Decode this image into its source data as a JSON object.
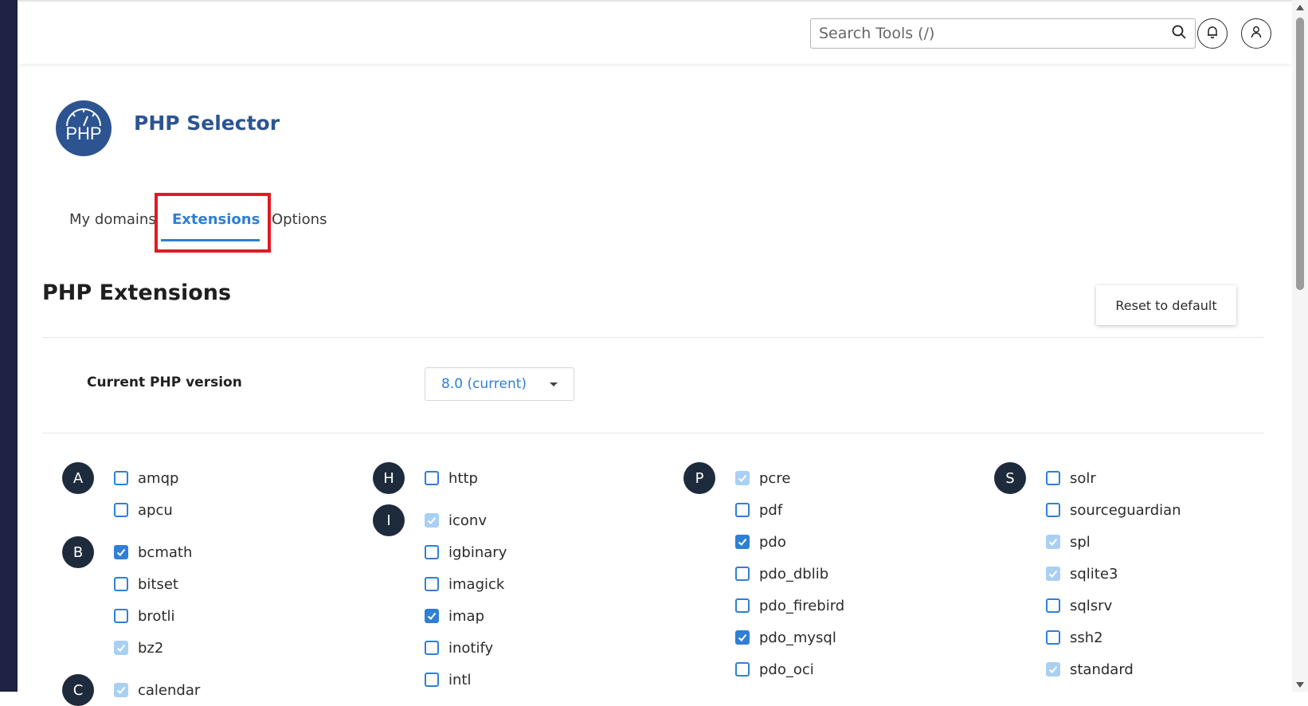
{
  "header": {
    "search_placeholder": "Search Tools (/)",
    "icons": [
      "search-icon",
      "bell-icon",
      "user-icon"
    ]
  },
  "app": {
    "title": "PHP Selector",
    "logo_text": "PHP"
  },
  "tabs": [
    {
      "label": "My domains",
      "active": false
    },
    {
      "label": "Extensions",
      "active": true
    },
    {
      "label": "Options",
      "active": false
    }
  ],
  "section": {
    "title": "PHP Extensions",
    "reset_label": "Reset to default"
  },
  "version": {
    "label": "Current PHP version",
    "selected": "8.0 (current)"
  },
  "columns": [
    {
      "groups": [
        {
          "letter": "A",
          "items": [
            {
              "name": "amqp",
              "state": "unchecked"
            },
            {
              "name": "apcu",
              "state": "unchecked"
            }
          ]
        },
        {
          "letter": "B",
          "items": [
            {
              "name": "bcmath",
              "state": "checked"
            },
            {
              "name": "bitset",
              "state": "unchecked"
            },
            {
              "name": "brotli",
              "state": "unchecked"
            },
            {
              "name": "bz2",
              "state": "default"
            }
          ]
        },
        {
          "letter": "C",
          "items": [
            {
              "name": "calendar",
              "state": "default"
            }
          ]
        }
      ]
    },
    {
      "groups": [
        {
          "letter": "H",
          "items": [
            {
              "name": "http",
              "state": "unchecked"
            }
          ]
        },
        {
          "letter": "I",
          "items": [
            {
              "name": "iconv",
              "state": "default"
            },
            {
              "name": "igbinary",
              "state": "unchecked"
            },
            {
              "name": "imagick",
              "state": "unchecked"
            },
            {
              "name": "imap",
              "state": "checked"
            },
            {
              "name": "inotify",
              "state": "unchecked"
            },
            {
              "name": "intl",
              "state": "unchecked"
            }
          ]
        }
      ]
    },
    {
      "groups": [
        {
          "letter": "P",
          "items": [
            {
              "name": "pcre",
              "state": "default"
            },
            {
              "name": "pdf",
              "state": "unchecked"
            },
            {
              "name": "pdo",
              "state": "checked"
            },
            {
              "name": "pdo_dblib",
              "state": "unchecked"
            },
            {
              "name": "pdo_firebird",
              "state": "unchecked"
            },
            {
              "name": "pdo_mysql",
              "state": "checked"
            },
            {
              "name": "pdo_oci",
              "state": "unchecked"
            }
          ]
        }
      ]
    },
    {
      "groups": [
        {
          "letter": "S",
          "items": [
            {
              "name": "solr",
              "state": "unchecked"
            },
            {
              "name": "sourceguardian",
              "state": "unchecked"
            },
            {
              "name": "spl",
              "state": "default"
            },
            {
              "name": "sqlite3",
              "state": "default"
            },
            {
              "name": "sqlsrv",
              "state": "unchecked"
            },
            {
              "name": "ssh2",
              "state": "unchecked"
            },
            {
              "name": "standard",
              "state": "default"
            }
          ]
        }
      ]
    }
  ],
  "colors": {
    "accent": "#2f7fd6",
    "brand": "#2c5491",
    "highlight": "#e01b24",
    "sidebar": "#1f2245",
    "letter_badge": "#1e2b3c",
    "default_checkbox": "#a9d0f2"
  }
}
